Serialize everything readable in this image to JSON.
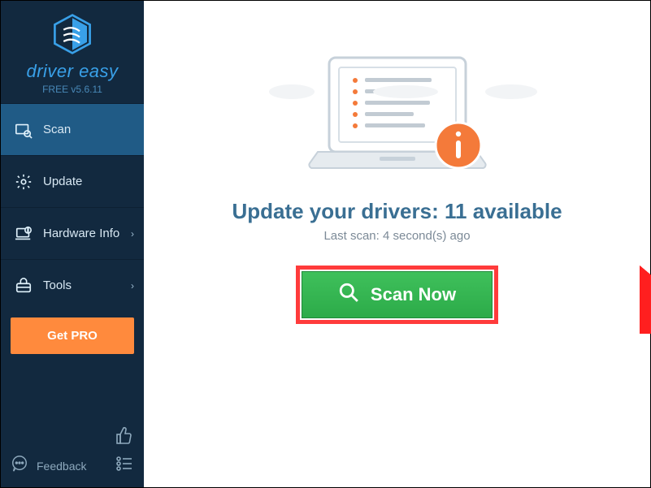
{
  "brand": {
    "name": "driver easy",
    "version": "FREE v5.6.11"
  },
  "sidebar": {
    "items": [
      {
        "label": "Scan"
      },
      {
        "label": "Update"
      },
      {
        "label": "Hardware Info"
      },
      {
        "label": "Tools"
      }
    ],
    "get_pro": "Get PRO",
    "feedback": "Feedback"
  },
  "main": {
    "headline_prefix": "Update your drivers: ",
    "available_count": "11",
    "headline_suffix": " available",
    "last_scan": "Last scan: 4 second(s) ago",
    "scan_button": "Scan Now"
  }
}
